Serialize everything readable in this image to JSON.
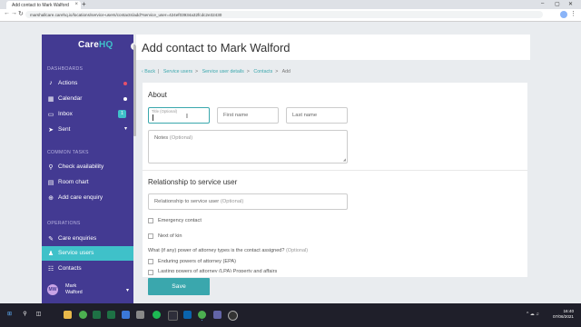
{
  "browser": {
    "tab_title": "Add contact to Mark Walford | C",
    "tab_close": "×",
    "new_tab": "+",
    "url": "marshallcare.carehq.io/locations/service-users/contacts/add?service_user=424ef03934a32fcdc2e32430",
    "window_controls": [
      "–",
      "▢",
      "✕"
    ],
    "nav": [
      "←",
      "→",
      "↻"
    ],
    "menu_dots": "⋮"
  },
  "sidebar": {
    "logo_prefix": "Care",
    "logo_suffix": "HQ",
    "collapse_icon": "‹",
    "sections": {
      "dashboards": "DASHBOARDS",
      "common_tasks": "COMMON TASKS",
      "operations": "OPERATIONS"
    },
    "items": [
      {
        "label": "Actions",
        "icon": "bell-icon",
        "glyph": "♪"
      },
      {
        "label": "Calendar",
        "icon": "calendar-icon",
        "glyph": "▦"
      },
      {
        "label": "Inbox",
        "icon": "inbox-icon",
        "glyph": "▭",
        "badge": "1"
      },
      {
        "label": "Sent",
        "icon": "send-icon",
        "glyph": "➤"
      },
      {
        "label": "Check availability",
        "icon": "search-icon",
        "glyph": "⚲"
      },
      {
        "label": "Room chart",
        "icon": "room-chart-icon",
        "glyph": "▤"
      },
      {
        "label": "Add care enquiry",
        "icon": "add-enquiry-icon",
        "glyph": "⊕"
      },
      {
        "label": "Care enquiries",
        "icon": "enquiries-icon",
        "glyph": "✎"
      },
      {
        "label": "Service users",
        "icon": "service-users-icon",
        "glyph": "♟"
      },
      {
        "label": "Contacts",
        "icon": "contacts-icon",
        "glyph": "☷"
      }
    ],
    "user": {
      "initials": "MW",
      "first": "Mark",
      "last": "Walford"
    },
    "accent": "#3fc1c9",
    "background": "#433a92"
  },
  "header": {
    "title": "Add contact to Mark Walford"
  },
  "breadcrumb": {
    "back": "‹ Back",
    "items": [
      "Service users",
      "Service user details",
      "Contacts"
    ],
    "current": "Add"
  },
  "form": {
    "about_heading": "About",
    "title_placeholder": "Title",
    "optional": "(Optional)",
    "first_name": "First name",
    "last_name": "Last name",
    "notes": "Notes",
    "relationship_heading": "Relationship to service user",
    "relationship_field": "Relationship to service user",
    "emergency_contact": "Emergency contact",
    "next_of_kin": "Next of kin",
    "poa_question": "What (if any) power of attorney types is the contact assigned?",
    "poa_options": [
      "Enduring powers of attorney (EPA)",
      "Lasting powers of attorney (LPA) Property and affairs"
    ],
    "save": "Save"
  },
  "taskbar": {
    "time": "16:40",
    "date": "07/06/2021",
    "icons": [
      "windows-icon",
      "search-icon",
      "task-view-icon",
      "file-explorer-icon",
      "chrome-icon",
      "excel-icon",
      "teams-icon",
      "settings-icon",
      "spotify-icon",
      "edge-icon",
      "outlook-icon",
      "chrome-active-icon",
      "teams-purple-icon",
      "photos-icon",
      "media-icon"
    ]
  }
}
